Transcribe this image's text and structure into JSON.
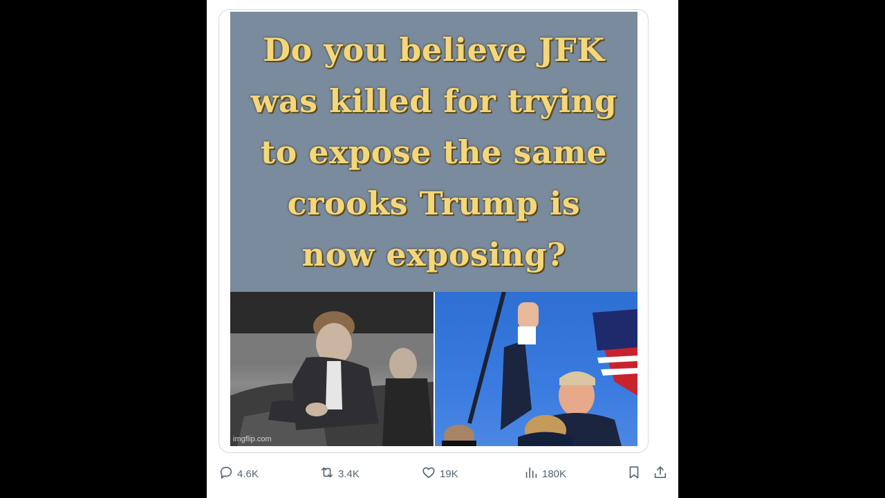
{
  "meme": {
    "caption": "Do you believe JFK\nwas killed for trying\nto expose the same\ncrooks Trump is\nnow exposing?",
    "watermark": "imgflip.com",
    "caption_bg": "#798b9d",
    "caption_color": "#f5d77a"
  },
  "actions": {
    "replies": "4.6K",
    "reposts": "3.4K",
    "likes": "19K",
    "views": "180K"
  },
  "icons": [
    "reply-icon",
    "repost-icon",
    "like-icon",
    "views-icon",
    "bookmark-icon",
    "share-icon"
  ]
}
